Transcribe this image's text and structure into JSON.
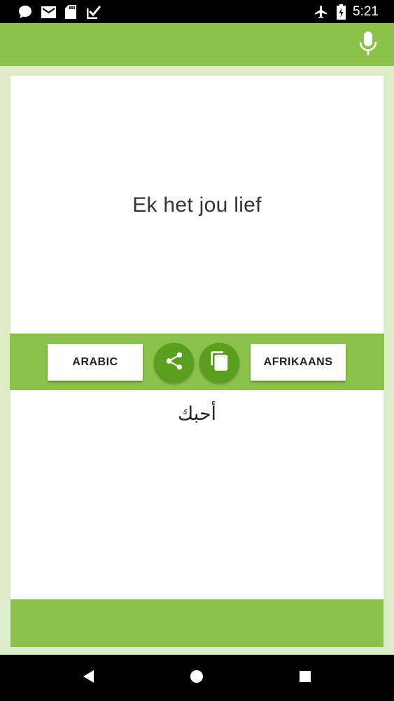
{
  "status_bar": {
    "time": "5:21",
    "left_icons": [
      "chat-icon",
      "mail-icon",
      "sd-card-icon",
      "check-box-icon"
    ],
    "right_icons": [
      "airplane-mode-icon",
      "battery-charging-icon"
    ]
  },
  "toolbar": {
    "mic_icon": "microphone-icon"
  },
  "translation": {
    "source_text": "Ek het jou lief",
    "target_text": "أحبك"
  },
  "controls": {
    "from_language": "ARABIC",
    "to_language": "AFRIKAANS",
    "share_icon": "share-icon",
    "copy_icon": "copy-icon"
  },
  "nav": {
    "back_icon": "back-icon",
    "home_icon": "home-icon",
    "recents_icon": "recents-icon"
  },
  "colors": {
    "primary": "#8bc34a",
    "primary_dark": "#5a9e1e",
    "background": "#dcedc8"
  }
}
